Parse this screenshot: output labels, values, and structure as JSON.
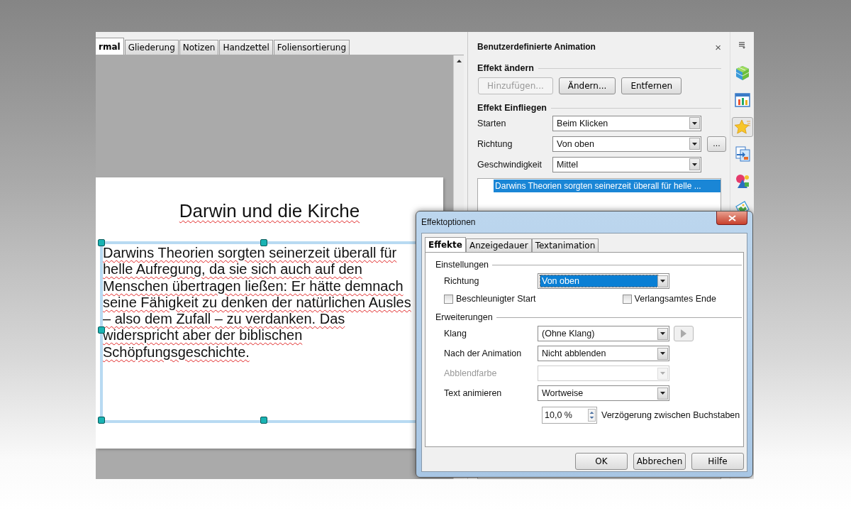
{
  "view_tabs": [
    {
      "label": "rmal",
      "selected": true
    },
    {
      "label": "Gliederung",
      "selected": false
    },
    {
      "label": "Notizen",
      "selected": false
    },
    {
      "label": "Handzettel",
      "selected": false
    },
    {
      "label": "Foliensortierung",
      "selected": false
    }
  ],
  "slide": {
    "title": "Darwin und die Kirche",
    "body_lines": [
      "Darwins Theorien sorgten seinerzeit überall für",
      "helle Aufregung, da sie sich auch auf den",
      "Menschen übertragen ließen: Er hätte demnach",
      "seine Fähigkeit zu denken der natürlichen Ausles",
      "– also dem Zufall – zu verdanken. Das",
      "widerspricht aber der biblischen",
      "Schöpfungsgeschichte."
    ]
  },
  "task_pane": {
    "title": "Benutzerdefinierte Animation",
    "close": "×",
    "change_effect": {
      "heading": "Effekt ändern",
      "buttons": [
        {
          "label": "Hinzufügen...",
          "disabled": true
        },
        {
          "label": "Ändern...",
          "disabled": false
        },
        {
          "label": "Entfernen",
          "disabled": false
        }
      ]
    },
    "effect": {
      "heading": "Effekt Einfliegen",
      "rows": [
        {
          "label": "Starten",
          "value": "Beim Klicken"
        },
        {
          "label": "Richtung",
          "value": "Von oben",
          "extra_button": "..."
        },
        {
          "label": "Geschwindigkeit",
          "value": "Mittel"
        }
      ]
    },
    "effects_list": [
      {
        "label": "Darwins Theorien sorgten seinerzeit überall für helle ...",
        "selected": true
      }
    ]
  },
  "sidebar": {
    "items": [
      {
        "kind": "menu",
        "selected": false
      },
      {
        "kind": "cube",
        "selected": false
      },
      {
        "kind": "chart",
        "selected": false
      },
      {
        "kind": "star",
        "selected": true
      },
      {
        "kind": "transition",
        "selected": false
      },
      {
        "kind": "shapes",
        "selected": false
      },
      {
        "kind": "image",
        "selected": false
      }
    ]
  },
  "dialog": {
    "title": "Effektoptionen",
    "tabs": [
      {
        "label": "Effekte",
        "selected": true
      },
      {
        "label": "Anzeigedauer",
        "selected": false
      },
      {
        "label": "Textanimation",
        "selected": false
      }
    ],
    "settings": {
      "heading": "Einstellungen",
      "direction": {
        "label": "Richtung",
        "value": "Von oben",
        "focused": true
      },
      "checkboxes": [
        {
          "label": "Beschleunigter Start",
          "checked": false
        },
        {
          "label": "Verlangsamtes Ende",
          "checked": false
        }
      ]
    },
    "extensions": {
      "heading": "Erweiterungen",
      "rows": [
        {
          "kind": "dropdown_play",
          "label": "Klang",
          "value": "(Ohne Klang)",
          "disabled": false
        },
        {
          "kind": "dropdown",
          "label": "Nach der Animation",
          "value": "Nicht abblenden",
          "disabled": false
        },
        {
          "kind": "dropdown",
          "label": "Abblendfarbe",
          "disabled": true
        },
        {
          "kind": "dropdown",
          "label": "Text animieren",
          "value": "Wortweise",
          "disabled": false
        },
        {
          "kind": "spin",
          "value": "10,0 %",
          "caption": "Verzögerung zwischen Buchstaben"
        }
      ]
    },
    "buttons": [
      {
        "label": "OK"
      },
      {
        "label": "Abbrechen"
      },
      {
        "label": "Hilfe"
      }
    ]
  }
}
